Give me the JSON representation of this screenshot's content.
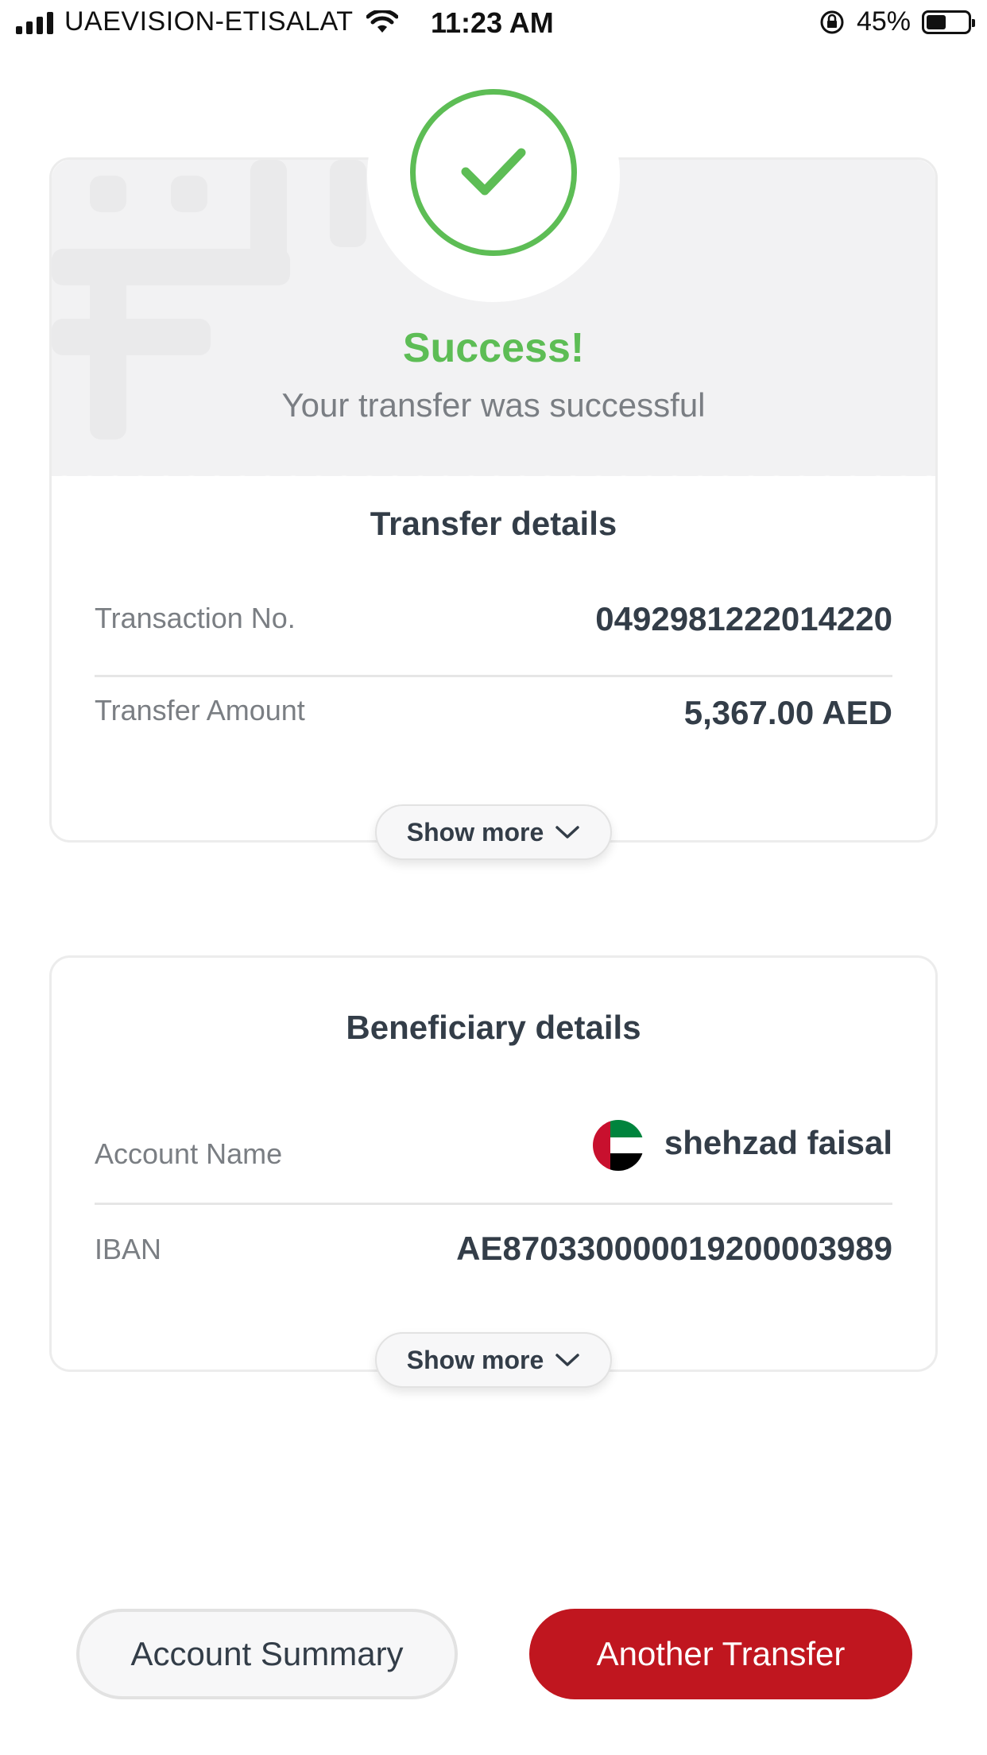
{
  "status_bar": {
    "carrier": "UAEVISION-ETISALAT",
    "time": "11:23 AM",
    "battery_percent": "45%"
  },
  "result": {
    "title": "Success!",
    "subtitle": "Your transfer was successful",
    "accent_color": "#5dbd55",
    "icon": "checkmark-icon"
  },
  "transfer_details": {
    "title": "Transfer details",
    "rows": [
      {
        "label": "Transaction No.",
        "value": "0492981222014220"
      },
      {
        "label": "Transfer Amount",
        "value": "5,367.00 AED"
      }
    ],
    "show_more_label": "Show more"
  },
  "beneficiary_details": {
    "title": "Beneficiary details",
    "rows": [
      {
        "label": "Account Name",
        "value": "shehzad faisal",
        "icon": "uae-flag-icon"
      },
      {
        "label": "IBAN",
        "value": "AE870330000019200003989"
      }
    ],
    "show_more_label": "Show more"
  },
  "actions": {
    "secondary_label": "Account Summary",
    "primary_label": "Another Transfer",
    "primary_color": "#c0161f"
  }
}
